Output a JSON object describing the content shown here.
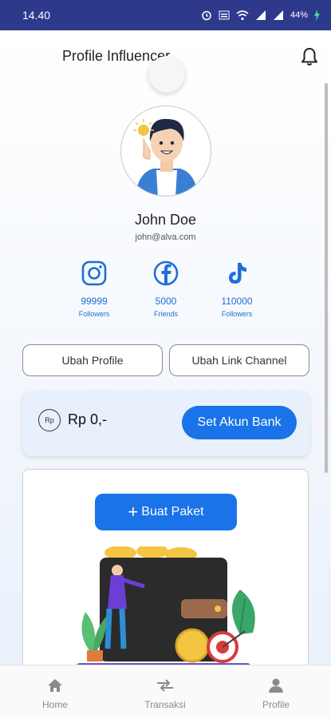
{
  "status_bar": {
    "time": "14.40",
    "battery": "44%"
  },
  "header": {
    "title": "Profile Influencer"
  },
  "profile": {
    "name": "John Doe",
    "email": "john@alva.com"
  },
  "social": [
    {
      "icon": "instagram-icon",
      "count": "99999",
      "label": "Followers"
    },
    {
      "icon": "facebook-icon",
      "count": "5000",
      "label": "Friends"
    },
    {
      "icon": "tiktok-icon",
      "count": "110000",
      "label": "Followers"
    }
  ],
  "actions": {
    "edit_profile": "Ubah Profile",
    "edit_channel": "Ubah Link Channel"
  },
  "bank": {
    "currency_icon": "Rp",
    "balance": "Rp 0,-",
    "set_bank_label": "Set Akun Bank"
  },
  "package": {
    "create_label": "Buat Paket"
  },
  "nav": [
    {
      "icon": "home-icon",
      "label": "Home"
    },
    {
      "icon": "transfer-icon",
      "label": "Transaksi"
    },
    {
      "icon": "person-icon",
      "label": "Profile"
    }
  ],
  "colors": {
    "status_bar": "#2d3a8c",
    "accent": "#1a73e8",
    "social": "#1e6fd6"
  }
}
